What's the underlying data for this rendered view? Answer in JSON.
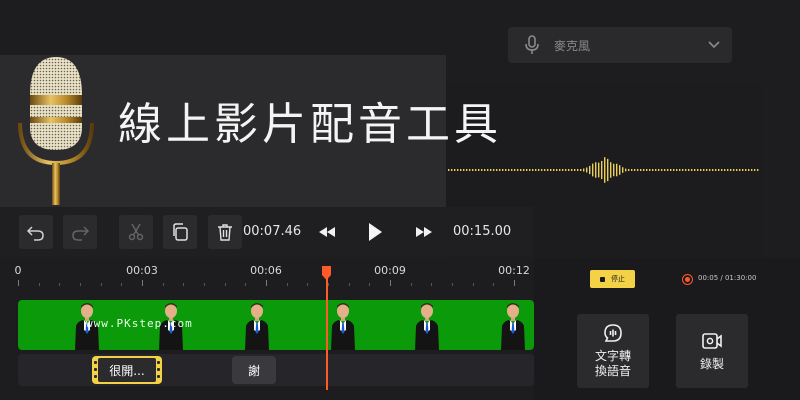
{
  "banner": {
    "title": "線上影片配音工具"
  },
  "mic_select": {
    "label": "麥克風"
  },
  "toolbar": {
    "current_time": "00:07.46",
    "total_time": "00:15.00"
  },
  "ruler": {
    "labels": [
      "0",
      "00:03",
      "00:06",
      "00:09",
      "00:12"
    ]
  },
  "video_track": {
    "watermark": "www.PKstep.com"
  },
  "audio_clips": [
    {
      "label": "很開..."
    },
    {
      "label": "謝"
    }
  ],
  "recording": {
    "stop_label": "停止",
    "time": "00:05 / 01:30:00"
  },
  "actions": {
    "tts_label": "文字轉\n換語音",
    "record_label": "錄製"
  },
  "colors": {
    "accent": "#f4d247",
    "playhead": "#ff5a2a",
    "track_green": "#0a9a0a",
    "background": "#1d1d1f"
  },
  "icons": [
    "microphone-icon",
    "chevron-down-icon",
    "undo-icon",
    "redo-icon",
    "scissors-icon",
    "copy-icon",
    "trash-icon",
    "rewind-icon",
    "play-icon",
    "fast-forward-icon",
    "text-to-speech-icon",
    "record-video-icon"
  ]
}
